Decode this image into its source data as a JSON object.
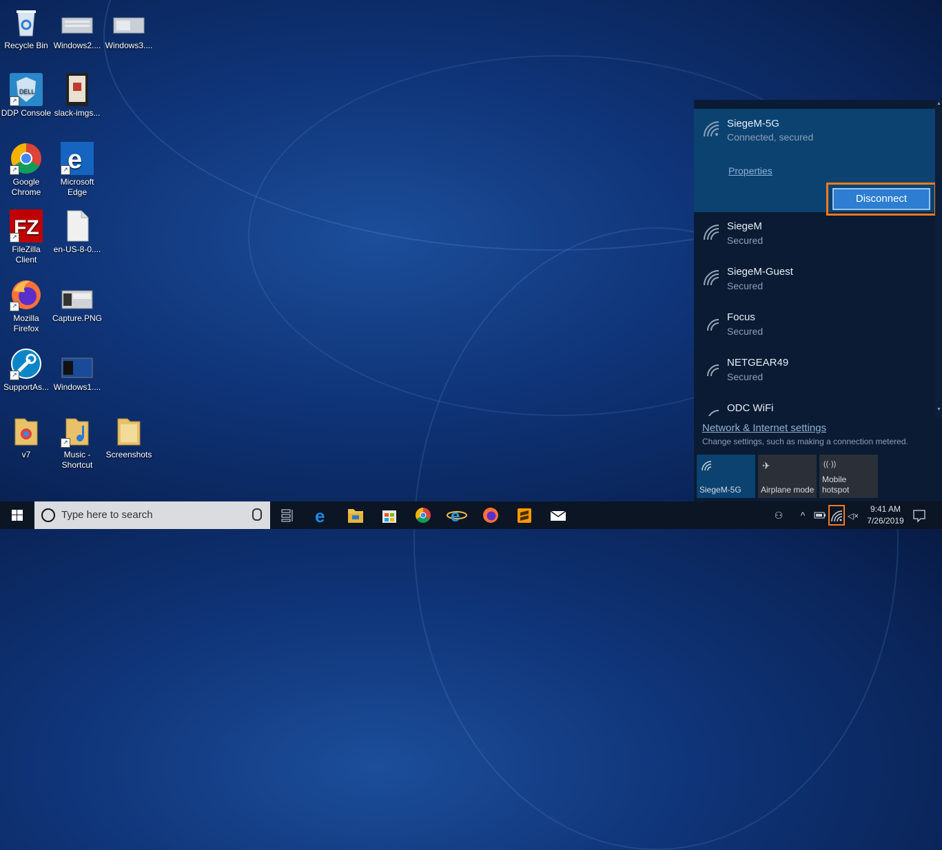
{
  "desktop": {
    "icons": [
      {
        "label": "Recycle Bin"
      },
      {
        "label": "Windows2...."
      },
      {
        "label": "Windows3...."
      },
      {
        "label": "DDP Console"
      },
      {
        "label": "slack-imgs..."
      },
      {
        "label": "Google Chrome"
      },
      {
        "label": "Microsoft Edge"
      },
      {
        "label": "FileZilla Client"
      },
      {
        "label": "en-US-8-0...."
      },
      {
        "label": "Mozilla Firefox"
      },
      {
        "label": "Capture.PNG"
      },
      {
        "label": "SupportAs..."
      },
      {
        "label": "Windows1...."
      },
      {
        "label": "v7"
      },
      {
        "label": "Music - Shortcut"
      },
      {
        "label": "Screenshots"
      }
    ]
  },
  "network_flyout": {
    "connected": {
      "ssid": "SiegeM-5G",
      "status": "Connected, secured",
      "properties_label": "Properties",
      "disconnect_label": "Disconnect"
    },
    "networks": [
      {
        "ssid": "SiegeM",
        "status": "Secured"
      },
      {
        "ssid": "SiegeM-Guest",
        "status": "Secured"
      },
      {
        "ssid": "Focus",
        "status": "Secured"
      },
      {
        "ssid": "NETGEAR49",
        "status": "Secured"
      },
      {
        "ssid": "ODC WiFi",
        "status": ""
      }
    ],
    "settings_link": "Network & Internet settings",
    "settings_desc": "Change settings, such as making a connection metered.",
    "quick_actions": [
      {
        "label": "SiegeM-5G",
        "icon": "wifi-icon",
        "active": true
      },
      {
        "label": "Airplane mode",
        "icon": "airplane-icon",
        "active": false
      },
      {
        "label": "Mobile hotspot",
        "icon": "hotspot-icon",
        "active": false
      }
    ]
  },
  "taskbar": {
    "search_placeholder": "Type here to search",
    "time": "9:41 AM",
    "date": "7/26/2019",
    "apps": [
      "task-view",
      "edge",
      "file-explorer",
      "store",
      "chrome",
      "internet-explorer",
      "firefox",
      "sublime-text",
      "mail"
    ]
  },
  "colors": {
    "accent": "#0b4270",
    "highlight": "#f47b20",
    "button": "#2d7dd2"
  }
}
